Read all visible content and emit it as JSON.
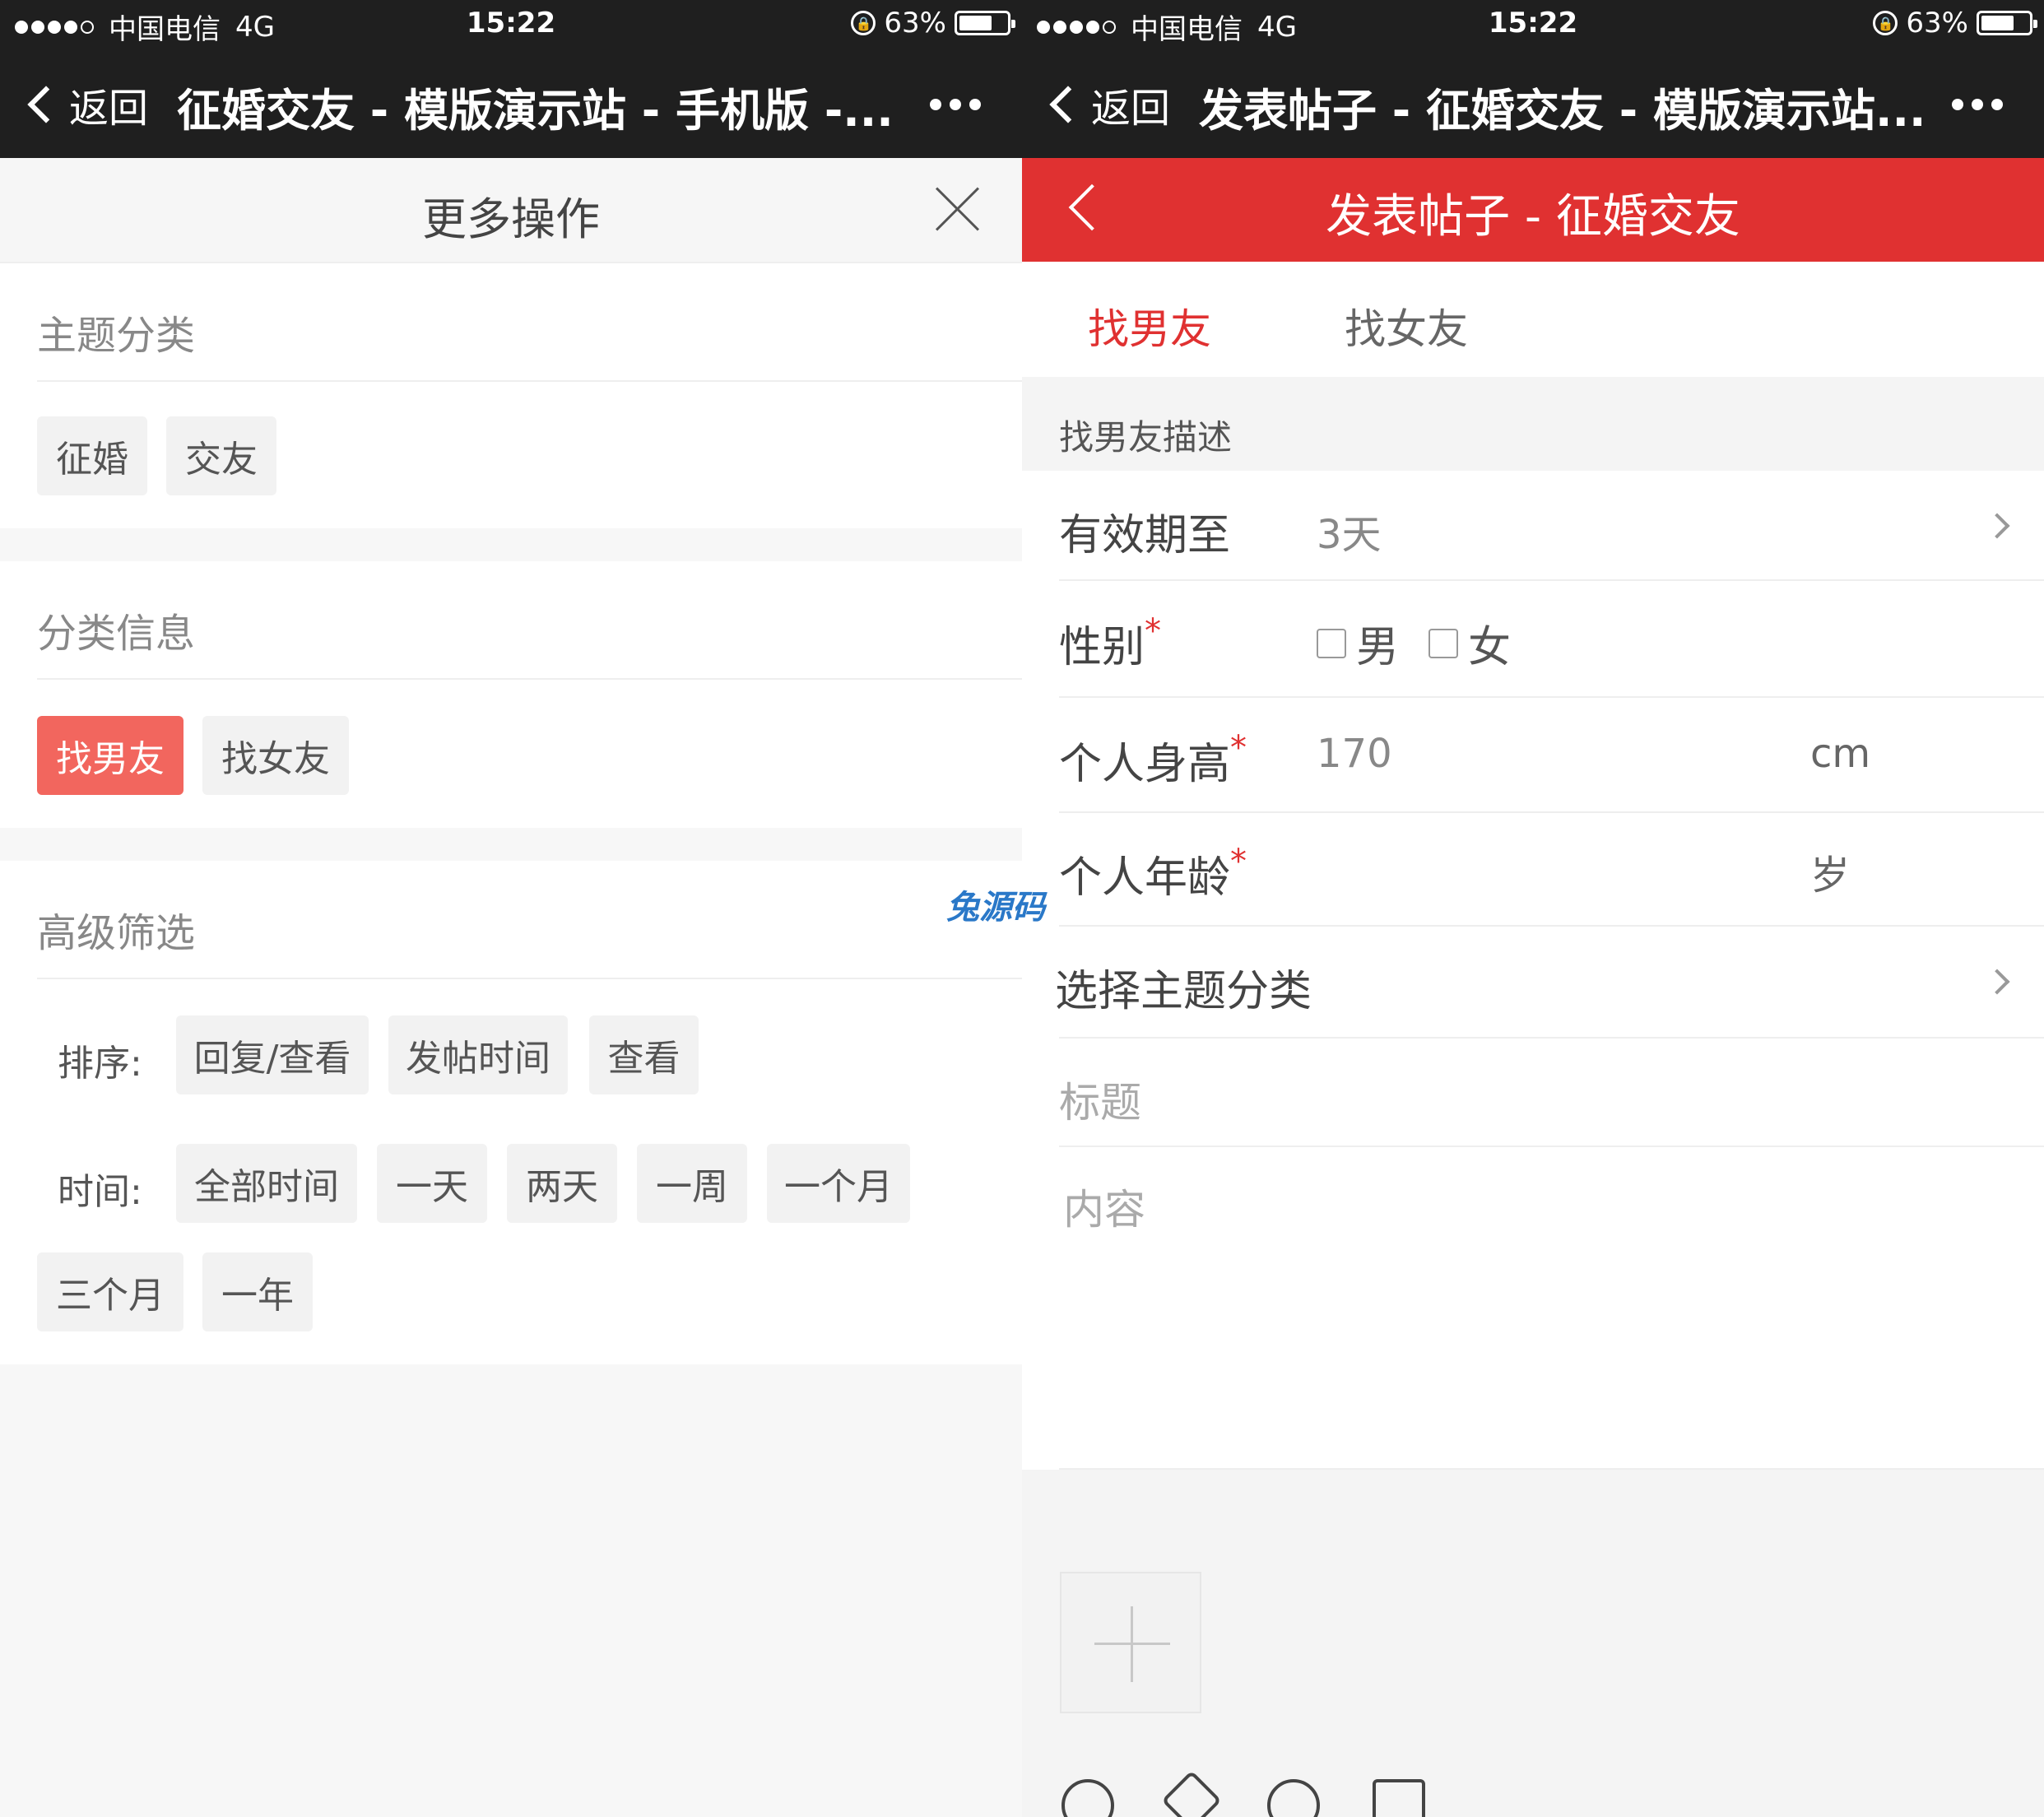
{
  "status": {
    "carrier": "中国电信",
    "network": "4G",
    "time": "15:22",
    "battery": "63%",
    "battery_fraction": 0.63
  },
  "left": {
    "back_label": "返回",
    "wx_title": "征婚交友 - 模版演示站 - 手机版 -...",
    "panel_title": "更多操作",
    "topic": {
      "title": "主题分类",
      "chips": [
        "征婚",
        "交友"
      ]
    },
    "category": {
      "title": "分类信息",
      "chips": [
        "找男友",
        "找女友"
      ],
      "active": "找男友"
    },
    "advanced": {
      "title": "高级筛选",
      "sort_label": "排序:",
      "sort_options": [
        "回复/查看",
        "发帖时间",
        "查看"
      ],
      "time_label": "时间:",
      "time_options": [
        "全部时间",
        "一天",
        "两天",
        "一周",
        "一个月",
        "三个月",
        "一年"
      ]
    }
  },
  "right": {
    "back_label": "返回",
    "wx_title": "发表帖子 - 征婚交友 - 模版演示站...",
    "page_title": "发表帖子 - 征婚交友",
    "tabs": [
      "找男友",
      "找女友"
    ],
    "active_tab": "找男友",
    "desc_label": "找男友描述",
    "fields": {
      "validity": {
        "label": "有效期至",
        "value": "3天"
      },
      "gender": {
        "label": "性别",
        "options": [
          "男",
          "女"
        ]
      },
      "height": {
        "label": "个人身高",
        "value": "170",
        "unit": "cm"
      },
      "age": {
        "label": "个人年龄",
        "value": "",
        "unit": "岁"
      },
      "topic": {
        "label": "选择主题分类"
      }
    },
    "title_placeholder": "标题",
    "content_placeholder": "内容",
    "required_mark": "*"
  },
  "watermark": "兔源码",
  "colors": {
    "accent_red": "#e03131",
    "chip_active": "#f2665e",
    "header_bg": "#1f1f1f"
  }
}
